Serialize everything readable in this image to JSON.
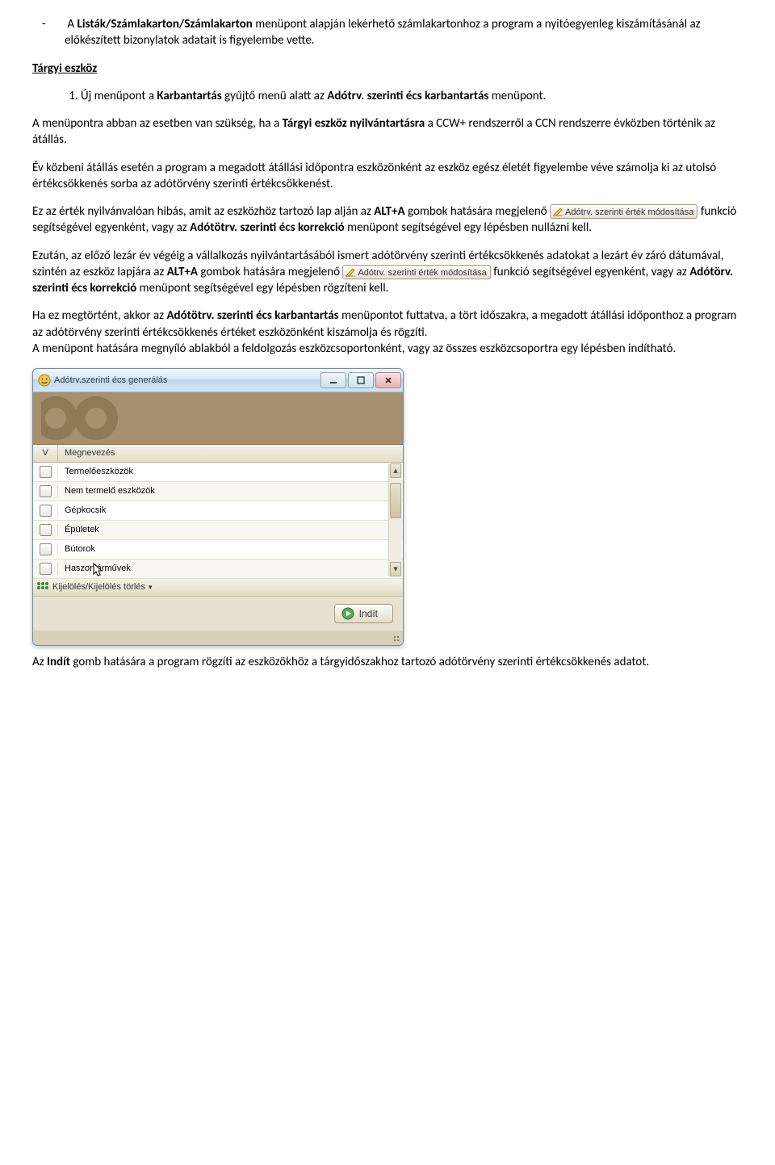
{
  "bullet1_pre": "A ",
  "bullet1_bold": "Listák/Számlakarton/Számlakarton",
  "bullet1_post": " menüpont alapján lekérhető számlakartonhoz a program a nyitóegyenleg kiszámításánál az előkészített bizonylatok adatait is figyelembe vette.",
  "heading_targyi": "Tárgyi eszköz",
  "num1_pre": "Új menüpont a ",
  "num1_bold1": "Karbantartás",
  "num1_mid": " gyűjtő menü alatt az ",
  "num1_bold2": "Adótrv. szerinti écs karbantartás",
  "num1_post": " menüpont.",
  "p_need_pre": "A menüpontra abban az esetben van szükség, ha a ",
  "p_need_bold": "Tárgyi eszköz nyilvántartásra",
  "p_need_post": " a CCW+ rendszerről a CCN rendszerre évközben történik az átállás.",
  "p_year": "Év közbeni átállás esetén a program a megadott átállási időpontra eszközönként az eszköz egész életét figyelembe véve számolja ki az utolsó értékcsökkenés sorba az adótörvény szerinti értékcsökkenést.",
  "p_wrong_pre": "Ez az érték nyilvánvalóan hibás, amit az eszközhöz tartozó lap alján az ",
  "p_wrong_b1": "ALT+A",
  "p_wrong_mid": " gombok hatására megjelenő ",
  "inlinebtn_label": "Adótrv. szerinti érték módosítása",
  "p_wrong_mid2": " funkció segítségével egyenként, vagy az ",
  "p_wrong_b2": "Adótötrv. szerinti écs korrekció",
  "p_wrong_post": " menüpont segítségével egy lépésben nullázni kell.",
  "p_after_pre": "Ezután, az előző lezár év végéig a vállalkozás nyilvántartásából ismert adótörvény szerinti értékcsökkenés adatokat a lezárt év záró dátumával, szintén az eszköz lapjára az ",
  "p_after_b1": "ALT+A",
  "p_after_mid": " gombok hatására megjelenő ",
  "p_after_mid2": " funkció segítségével egyenként, vagy az ",
  "p_after_b2": "Adótörv. szerinti écs korrekció",
  "p_after_post": " menüpont segítségével egy lépésben rögzíteni kell.",
  "p_done_pre": "Ha ez megtörtént, akkor az ",
  "p_done_b": "Adótötrv. szerinti écs karbantartás",
  "p_done_post": " menüpontot futtatva, a tört időszakra, a megadott átállási időponthoz a program az adótörvény szerinti értékcsökkenés értéket eszközönként kiszámolja és rögzíti.",
  "p_done2": "A menüpont hatására megnyíló ablakból a feldolgozás eszközcsoportonként, vagy az összes eszközcsoportra egy lépésben indítható.",
  "dialog": {
    "title": "Adótrv.szerinti écs generálás",
    "hdr_v": "V",
    "hdr_name": "Megnevezés",
    "rows": [
      "Termelőeszközök",
      "Nem termelő eszközök",
      "Gépkocsik",
      "Épületek",
      "Bútorok",
      "Haszonjárművek"
    ],
    "selkij": "Kijelölés/Kijelölés törlés",
    "run": "Indít"
  },
  "p_last_pre": "Az ",
  "p_last_b": "Indít",
  "p_last_post": " gomb hatására a program rögzíti az eszközökhöz a tárgyidőszakhoz tartozó adótörvény szerinti értékcsökkenés adatot."
}
